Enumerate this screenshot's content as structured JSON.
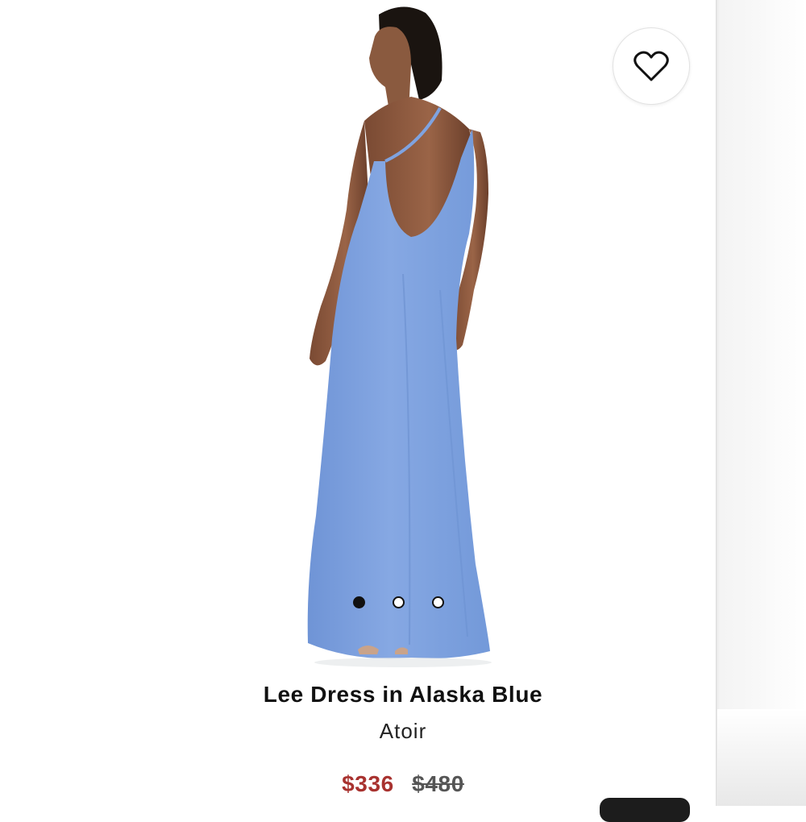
{
  "product": {
    "name": "Lee Dress in Alaska Blue",
    "brand": "Atoir",
    "price_sale": "$336",
    "price_original": "$480"
  },
  "gallery": {
    "image_count": 3,
    "active_index": 0
  },
  "colors": {
    "dress": "#7fa3e0",
    "sale_price": "#a8322f",
    "text": "#111111"
  },
  "icons": {
    "favorite": "heart-outline-icon"
  }
}
